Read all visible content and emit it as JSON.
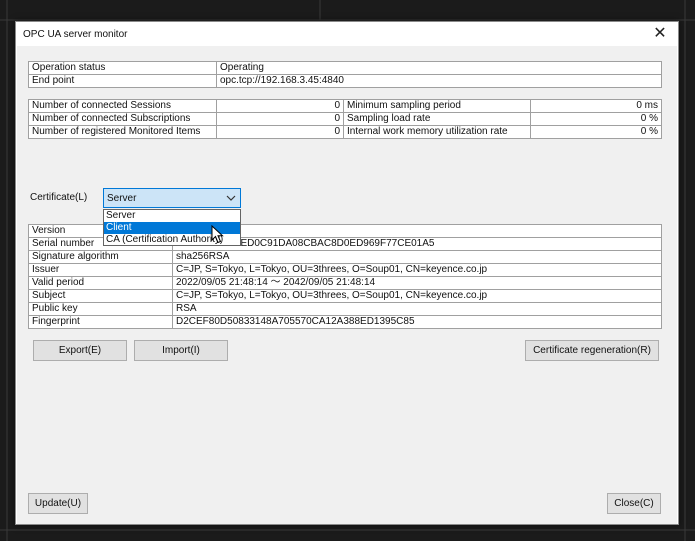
{
  "dialog": {
    "title": "OPC UA server monitor"
  },
  "status": {
    "rows": [
      {
        "label": "Operation status",
        "value": "Operating"
      },
      {
        "label": "End point",
        "value": "opc.tcp://192.168.3.45:4840"
      }
    ]
  },
  "metrics": {
    "left": [
      {
        "label": "Number of connected Sessions",
        "value": "0"
      },
      {
        "label": "Number of connected Subscriptions",
        "value": "0"
      },
      {
        "label": "Number of registered Monitored Items",
        "value": "0"
      }
    ],
    "right": [
      {
        "label": "Minimum sampling period",
        "value": "0 ms"
      },
      {
        "label": "Sampling load rate",
        "value": "0 %"
      },
      {
        "label": "Internal work memory utilization rate",
        "value": "0 %"
      }
    ]
  },
  "certificate": {
    "label": "Certificate(L)",
    "selected": "Server",
    "options": [
      "Server",
      "Client",
      "CA (Certification Authority)"
    ],
    "highlighted_option": "Client",
    "details": [
      {
        "label": "Version",
        "value": ""
      },
      {
        "label": "Serial number",
        "value": "4BEDD0C0C6ED0C91DA08CBAC8D0ED969F77CE01A5"
      },
      {
        "label": "Signature algorithm",
        "value": "sha256RSA"
      },
      {
        "label": "Issuer",
        "value": "C=JP, S=Tokyo, L=Tokyo, OU=3threes, O=Soup01, CN=keyence.co.jp"
      },
      {
        "label": "Valid period",
        "value": "2022/09/05 21:48:14 〜 2042/09/05 21:48:14"
      },
      {
        "label": "Subject",
        "value": "C=JP, S=Tokyo, L=Tokyo, OU=3threes, O=Soup01, CN=keyence.co.jp"
      },
      {
        "label": "Public key",
        "value": "RSA"
      },
      {
        "label": "Fingerprint",
        "value": "D2CEF80D50833148A705570CA12A388ED1395C85"
      }
    ]
  },
  "buttons": {
    "export": "Export(E)",
    "import": "Import(I)",
    "regen": "Certificate regeneration(R)",
    "update": "Update(U)",
    "close": "Close(C)"
  },
  "icons": {
    "close": "close-icon",
    "dropdown": "chevron-down-icon",
    "pointer": "mouse-pointer-icon"
  },
  "colors": {
    "selection": "#0078d7",
    "combo_bg": "#cce4f7",
    "panel": "#f0f0f0"
  }
}
